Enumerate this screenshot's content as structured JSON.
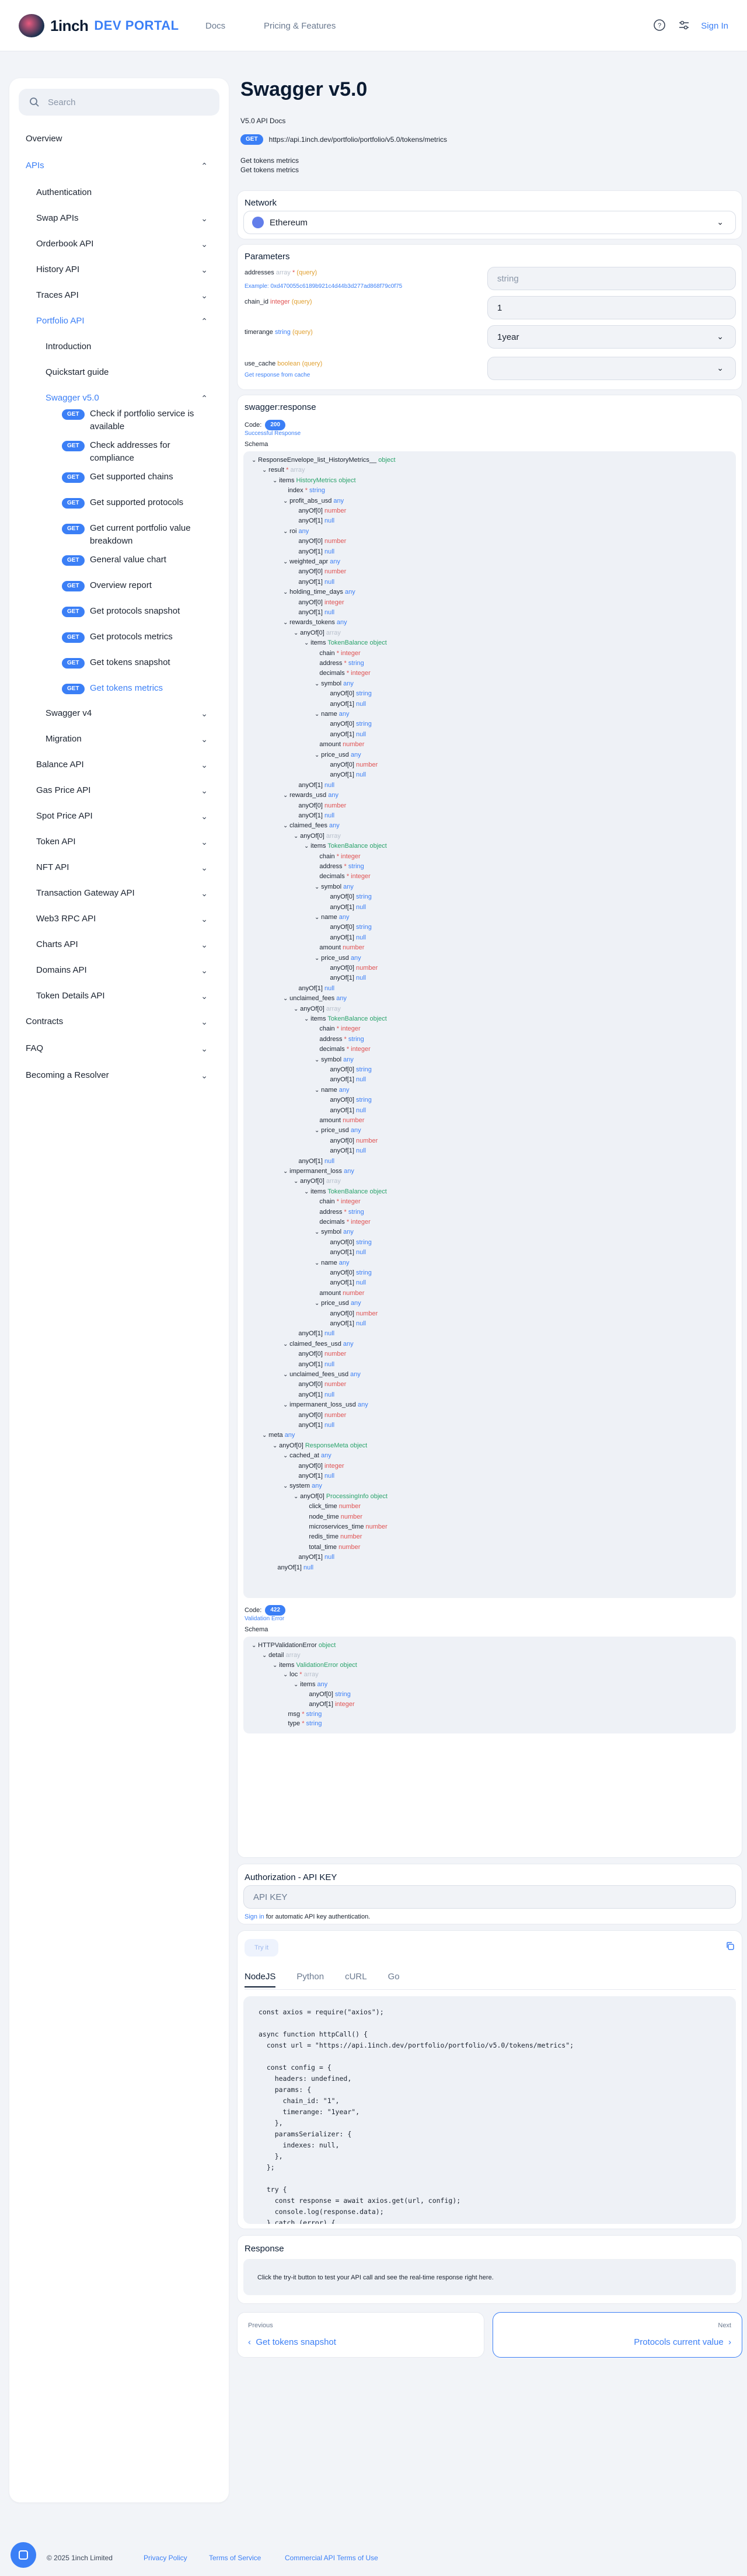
{
  "header": {
    "logo_text": "1inch",
    "portal_text": "DEV PORTAL",
    "nav": [
      "Docs",
      "Pricing & Features"
    ],
    "signin": "Sign In"
  },
  "sidebar": {
    "search_placeholder": "Search",
    "overview": "Overview",
    "apis": "APIs",
    "authentication": "Authentication",
    "swap": "Swap APIs",
    "orderbook": "Orderbook API",
    "history": "History API",
    "traces": "Traces API",
    "portfolio": "Portfolio API",
    "introduction": "Introduction",
    "quickstart": "Quickstart guide",
    "swagger5": "Swagger v5.0",
    "get": "GET",
    "endpoints": [
      "Check if portfolio service is available",
      "Check addresses for compliance",
      "Get supported chains",
      "Get supported protocols",
      "Get current portfolio value breakdown",
      "General value chart",
      "Overview report",
      "Get protocols snapshot",
      "Get protocols metrics",
      "Get tokens snapshot",
      "Get tokens metrics"
    ],
    "swagger4": "Swagger v4",
    "migration": "Migration",
    "rest": [
      "Balance API",
      "Gas Price API",
      "Spot Price API",
      "Token API",
      "NFT API",
      "Transaction Gateway API",
      "Web3 RPC API",
      "Charts API",
      "Domains API",
      "Token Details API"
    ],
    "bottom": [
      "Contracts",
      "FAQ",
      "Becoming a Resolver"
    ]
  },
  "page": {
    "title": "Swagger v5.0",
    "subtitle": "V5.0 API Docs",
    "method": "GET",
    "url": "https://api.1inch.dev/portfolio/portfolio/v5.0/tokens/metrics",
    "desc1": "Get tokens metrics",
    "desc2": "Get tokens metrics"
  },
  "network": {
    "label": "Network",
    "value": "Ethereum"
  },
  "params": {
    "label": "Parameters",
    "addresses_name": "addresses",
    "addresses_type": "array",
    "addresses_star": "*",
    "addresses_in": "(query)",
    "addresses_example": "Example: 0xd470055c6189b921c4d44b3d277ad868f79c0f75",
    "addresses_value": "string",
    "chain_name": "chain_id",
    "chain_type": "integer",
    "chain_in": "(query)",
    "chain_value": "1",
    "timerange_name": "timerange",
    "timerange_type": "string",
    "timerange_in": "(query)",
    "timerange_value": "1year",
    "cache_name": "use_cache",
    "cache_type": "boolean",
    "cache_in": "(query)",
    "cache_desc": "Get response from cache",
    "cache_value": ""
  },
  "response": {
    "title": "swagger:response",
    "code_label": "Code:",
    "code200": "200",
    "code200_desc": "Successful Response",
    "schema": "Schema",
    "code422": "422",
    "code422_desc": "Validation Error"
  },
  "tree200": [
    [
      "ResponseEnvelope_list_HistoryMetrics__",
      "object",
      "",
      0
    ],
    [
      "result",
      "array",
      "*",
      1
    ],
    [
      "items",
      "HistoryMetrics object",
      "",
      2
    ],
    [
      "index",
      "string",
      "*",
      3
    ],
    [
      "profit_abs_usd",
      "any",
      "",
      3
    ],
    [
      "anyOf[0]",
      "number",
      "",
      4
    ],
    [
      "anyOf[1]",
      "null",
      "",
      4
    ],
    [
      "roi",
      "any",
      "",
      3
    ],
    [
      "anyOf[0]",
      "number",
      "",
      4
    ],
    [
      "anyOf[1]",
      "null",
      "",
      4
    ],
    [
      "weighted_apr",
      "any",
      "",
      3
    ],
    [
      "anyOf[0]",
      "number",
      "",
      4
    ],
    [
      "anyOf[1]",
      "null",
      "",
      4
    ],
    [
      "holding_time_days",
      "any",
      "",
      3
    ],
    [
      "anyOf[0]",
      "integer",
      "",
      4
    ],
    [
      "anyOf[1]",
      "null",
      "",
      4
    ],
    [
      "rewards_tokens",
      "any",
      "",
      3
    ],
    [
      "anyOf[0]",
      "array",
      "",
      4
    ],
    [
      "items",
      "TokenBalance object",
      "",
      5
    ],
    [
      "chain",
      "integer",
      "*",
      6
    ],
    [
      "address",
      "string",
      "*",
      6
    ],
    [
      "decimals",
      "integer",
      "*",
      6
    ],
    [
      "symbol",
      "any",
      "",
      6
    ],
    [
      "anyOf[0]",
      "string",
      "",
      7
    ],
    [
      "anyOf[1]",
      "null",
      "",
      7
    ],
    [
      "name",
      "any",
      "",
      6
    ],
    [
      "anyOf[0]",
      "string",
      "",
      7
    ],
    [
      "anyOf[1]",
      "null",
      "",
      7
    ],
    [
      "amount",
      "number",
      "",
      6
    ],
    [
      "price_usd",
      "any",
      "",
      6
    ],
    [
      "anyOf[0]",
      "number",
      "",
      7
    ],
    [
      "anyOf[1]",
      "null",
      "",
      7
    ],
    [
      "anyOf[1]",
      "null",
      "",
      4
    ],
    [
      "rewards_usd",
      "any",
      "",
      3
    ],
    [
      "anyOf[0]",
      "number",
      "",
      4
    ],
    [
      "anyOf[1]",
      "null",
      "",
      4
    ],
    [
      "claimed_fees",
      "any",
      "",
      3
    ],
    [
      "anyOf[0]",
      "array",
      "",
      4
    ],
    [
      "items",
      "TokenBalance object",
      "",
      5
    ],
    [
      "chain",
      "integer",
      "*",
      6
    ],
    [
      "address",
      "string",
      "*",
      6
    ],
    [
      "decimals",
      "integer",
      "*",
      6
    ],
    [
      "symbol",
      "any",
      "",
      6
    ],
    [
      "anyOf[0]",
      "string",
      "",
      7
    ],
    [
      "anyOf[1]",
      "null",
      "",
      7
    ],
    [
      "name",
      "any",
      "",
      6
    ],
    [
      "anyOf[0]",
      "string",
      "",
      7
    ],
    [
      "anyOf[1]",
      "null",
      "",
      7
    ],
    [
      "amount",
      "number",
      "",
      6
    ],
    [
      "price_usd",
      "any",
      "",
      6
    ],
    [
      "anyOf[0]",
      "number",
      "",
      7
    ],
    [
      "anyOf[1]",
      "null",
      "",
      7
    ],
    [
      "anyOf[1]",
      "null",
      "",
      4
    ],
    [
      "unclaimed_fees",
      "any",
      "",
      3
    ],
    [
      "anyOf[0]",
      "array",
      "",
      4
    ],
    [
      "items",
      "TokenBalance object",
      "",
      5
    ],
    [
      "chain",
      "integer",
      "*",
      6
    ],
    [
      "address",
      "string",
      "*",
      6
    ],
    [
      "decimals",
      "integer",
      "*",
      6
    ],
    [
      "symbol",
      "any",
      "",
      6
    ],
    [
      "anyOf[0]",
      "string",
      "",
      7
    ],
    [
      "anyOf[1]",
      "null",
      "",
      7
    ],
    [
      "name",
      "any",
      "",
      6
    ],
    [
      "anyOf[0]",
      "string",
      "",
      7
    ],
    [
      "anyOf[1]",
      "null",
      "",
      7
    ],
    [
      "amount",
      "number",
      "",
      6
    ],
    [
      "price_usd",
      "any",
      "",
      6
    ],
    [
      "anyOf[0]",
      "number",
      "",
      7
    ],
    [
      "anyOf[1]",
      "null",
      "",
      7
    ],
    [
      "anyOf[1]",
      "null",
      "",
      4
    ],
    [
      "impermanent_loss",
      "any",
      "",
      3
    ],
    [
      "anyOf[0]",
      "array",
      "",
      4
    ],
    [
      "items",
      "TokenBalance object",
      "",
      5
    ],
    [
      "chain",
      "integer",
      "*",
      6
    ],
    [
      "address",
      "string",
      "*",
      6
    ],
    [
      "decimals",
      "integer",
      "*",
      6
    ],
    [
      "symbol",
      "any",
      "",
      6
    ],
    [
      "anyOf[0]",
      "string",
      "",
      7
    ],
    [
      "anyOf[1]",
      "null",
      "",
      7
    ],
    [
      "name",
      "any",
      "",
      6
    ],
    [
      "anyOf[0]",
      "string",
      "",
      7
    ],
    [
      "anyOf[1]",
      "null",
      "",
      7
    ],
    [
      "amount",
      "number",
      "",
      6
    ],
    [
      "price_usd",
      "any",
      "",
      6
    ],
    [
      "anyOf[0]",
      "number",
      "",
      7
    ],
    [
      "anyOf[1]",
      "null",
      "",
      7
    ],
    [
      "anyOf[1]",
      "null",
      "",
      4
    ],
    [
      "claimed_fees_usd",
      "any",
      "",
      3
    ],
    [
      "anyOf[0]",
      "number",
      "",
      4
    ],
    [
      "anyOf[1]",
      "null",
      "",
      4
    ],
    [
      "unclaimed_fees_usd",
      "any",
      "",
      3
    ],
    [
      "anyOf[0]",
      "number",
      "",
      4
    ],
    [
      "anyOf[1]",
      "null",
      "",
      4
    ],
    [
      "impermanent_loss_usd",
      "any",
      "",
      3
    ],
    [
      "anyOf[0]",
      "number",
      "",
      4
    ],
    [
      "anyOf[1]",
      "null",
      "",
      4
    ],
    [
      "meta",
      "any",
      "",
      1
    ],
    [
      "anyOf[0]",
      "ResponseMeta object",
      "",
      2
    ],
    [
      "cached_at",
      "any",
      "",
      3
    ],
    [
      "anyOf[0]",
      "integer",
      "",
      4
    ],
    [
      "anyOf[1]",
      "null",
      "",
      4
    ],
    [
      "system",
      "any",
      "",
      3
    ],
    [
      "anyOf[0]",
      "ProcessingInfo object",
      "",
      4
    ],
    [
      "click_time",
      "number",
      "",
      5
    ],
    [
      "node_time",
      "number",
      "",
      5
    ],
    [
      "microservices_time",
      "number",
      "",
      5
    ],
    [
      "redis_time",
      "number",
      "",
      5
    ],
    [
      "total_time",
      "number",
      "",
      5
    ],
    [
      "anyOf[1]",
      "null",
      "",
      4
    ],
    [
      "anyOf[1]",
      "null",
      "",
      2
    ]
  ],
  "tree422": [
    [
      "HTTPValidationError",
      "object",
      "",
      0
    ],
    [
      "detail",
      "array",
      "",
      1
    ],
    [
      "items",
      "ValidationError object",
      "",
      2
    ],
    [
      "loc",
      "array",
      "*",
      3
    ],
    [
      "items",
      "any",
      "",
      4
    ],
    [
      "anyOf[0]",
      "string",
      "",
      5
    ],
    [
      "anyOf[1]",
      "integer",
      "",
      5
    ],
    [
      "msg",
      "string",
      "*",
      3
    ],
    [
      "type",
      "string",
      "*",
      3
    ]
  ],
  "auth": {
    "title": "Authorization - API KEY",
    "placeholder": "API KEY",
    "signin": "Sign in",
    "note": " for automatic API key authentication."
  },
  "tryit": {
    "button": "Try it",
    "tabs": [
      "NodeJS",
      "Python",
      "cURL",
      "Go"
    ],
    "code": [
      "const axios = require(\"axios\");",
      "",
      "async function httpCall() {",
      "  const url = \"https://api.1inch.dev/portfolio/portfolio/v5.0/tokens/metrics\";",
      "",
      "  const config = {",
      "    headers: undefined,",
      "    params: {",
      "      chain_id: \"1\",",
      "      timerange: \"1year\",",
      "    },",
      "    paramsSerializer: {",
      "      indexes: null,",
      "    },",
      "  };",
      "",
      "  try {",
      "    const response = await axios.get(url, config);",
      "    console.log(response.data);",
      "  } catch (error) {"
    ]
  },
  "resp": {
    "title": "Response",
    "hint": "Click the try-it button to test your API call and see the real-time response right here."
  },
  "pager": {
    "prev_label": "Previous",
    "prev_title": "Get tokens snapshot",
    "next_label": "Next",
    "next_title": "Protocols current value"
  },
  "footer": {
    "copyright": "© 2025 1inch Limited",
    "links": [
      "Privacy Policy",
      "Terms of Service",
      "Commercial API Terms of Use"
    ]
  }
}
